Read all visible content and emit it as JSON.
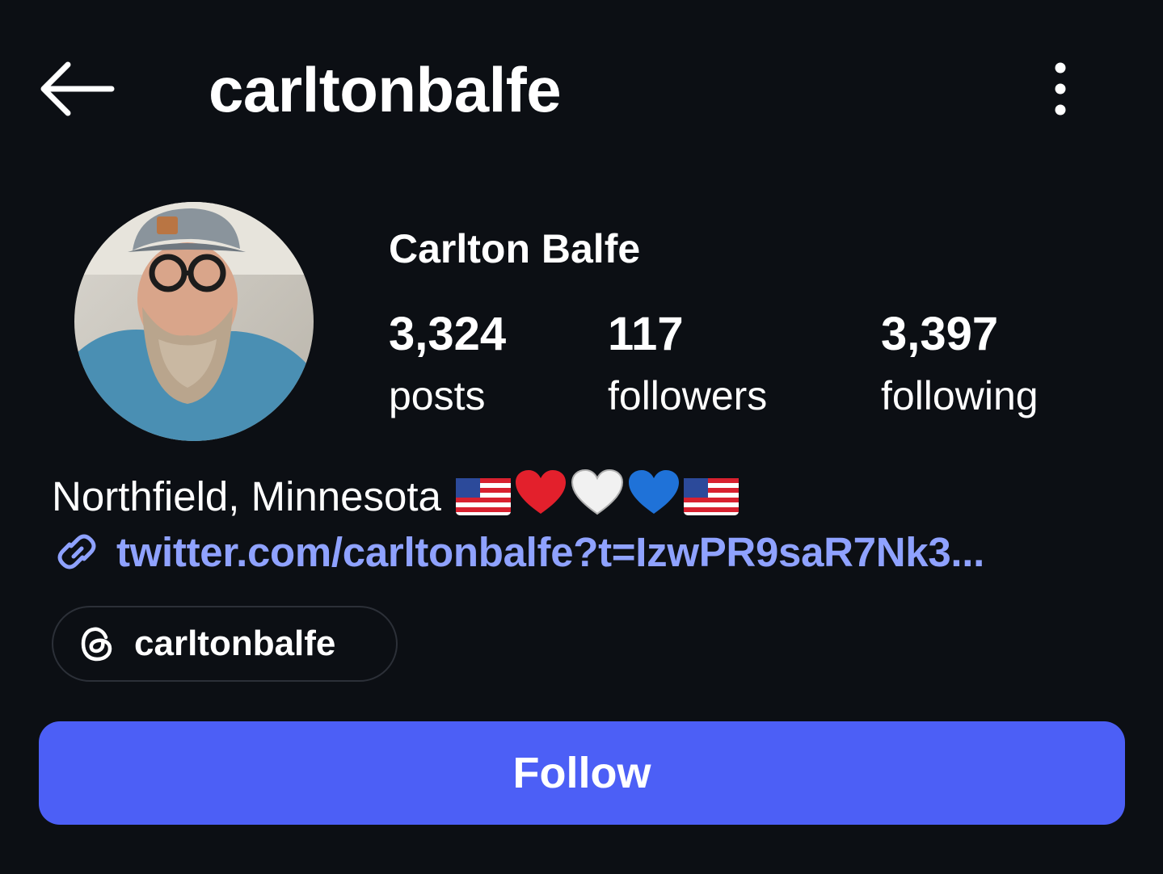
{
  "header": {
    "username": "carltonbalfe",
    "back_icon": "arrow-left-icon",
    "more_icon": "vertical-ellipsis-icon"
  },
  "profile": {
    "display_name": "Carlton Balfe",
    "stats": {
      "posts": {
        "count": "3,324",
        "label": "posts"
      },
      "followers": {
        "count": "117",
        "label": "followers"
      },
      "following": {
        "count": "3,397",
        "label": "following"
      }
    },
    "bio": "Northfield, Minnesota",
    "bio_emoji": [
      "us-flag",
      "red-heart",
      "white-heart",
      "blue-heart",
      "us-flag"
    ],
    "link": "twitter.com/carltonbalfe?t=IzwPR9saR7Nk3...",
    "threads_handle": "carltonbalfe"
  },
  "actions": {
    "follow_label": "Follow"
  },
  "colors": {
    "background": "#0c0f14",
    "accent": "#4c5ff6",
    "link": "#8fa2ff",
    "pill_border": "#2c3038"
  }
}
